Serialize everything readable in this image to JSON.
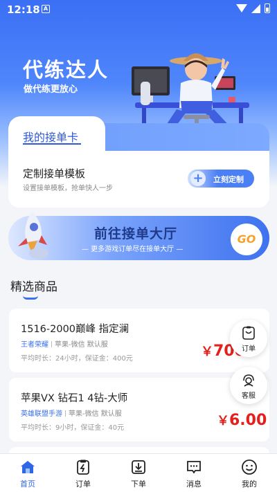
{
  "status_bar": {
    "time": "12:18",
    "nfc_glyph": "A"
  },
  "hero": {
    "title": "代练达人",
    "subtitle": "做代练更放心"
  },
  "card": {
    "tab_label": "我的接单卡",
    "template_title": "定制接单模板",
    "template_desc": "设置接单模板，抢单快人一步",
    "custom_button": "立刻定制",
    "plus_glyph": "+"
  },
  "banner": {
    "title": "前往接单大厅",
    "subtitle": "— 更多游戏订单尽在接单大厅 —",
    "go_label": "GO"
  },
  "section": {
    "title": "精选商品"
  },
  "products": [
    {
      "title": "1516-2000巅峰 指定澜",
      "game": "王者荣耀",
      "platform": "苹果-微信 默认服",
      "meta": "平均时长：24小时，保证金：400元",
      "currency": "￥",
      "price": "700"
    },
    {
      "title": "苹果VX 钻石1 4钻-大师",
      "game": "英雄联盟手游",
      "platform": "苹果-微信 默认服",
      "meta": "平均时长：9小时，保证金：40元",
      "currency": "￥",
      "price": "6.00"
    }
  ],
  "float_buttons": [
    {
      "label": "订单",
      "icon": "order-icon"
    },
    {
      "label": "客服",
      "icon": "customer-service-icon"
    }
  ],
  "tabbar": [
    {
      "label": "首页",
      "icon": "home-icon",
      "active": true
    },
    {
      "label": "订单",
      "icon": "clipboard-icon",
      "active": false
    },
    {
      "label": "下单",
      "icon": "download-icon",
      "active": false
    },
    {
      "label": "消息",
      "icon": "message-icon",
      "active": false
    },
    {
      "label": "我的",
      "icon": "smile-icon",
      "active": false
    }
  ],
  "colors": {
    "primary": "#2f66e8",
    "price": "#e3201b",
    "accent_go": "#f4a12b"
  }
}
